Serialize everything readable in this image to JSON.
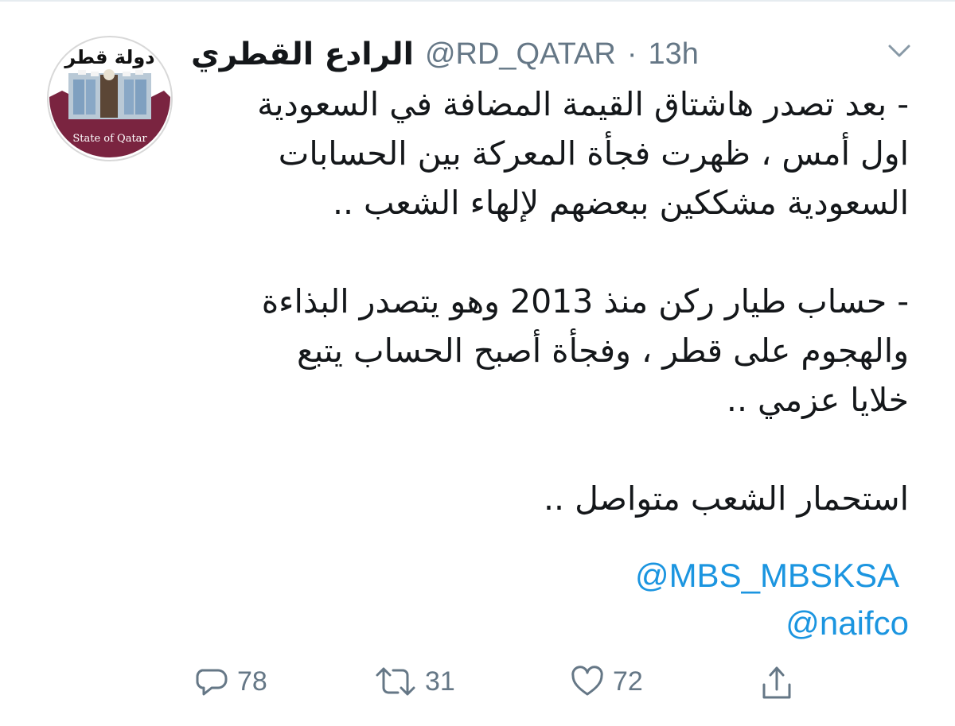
{
  "tweet": {
    "author": {
      "display_name": "الرادع القطري",
      "handle": "@RD_QATAR",
      "separator": "·",
      "time": "13h",
      "avatar_text_top": "دولة قطر",
      "avatar_text_bottom": "State of Qatar"
    },
    "menu_icon": "chevron-down-icon",
    "body_lines": [
      "- بعد تصدر هاشتاق القيمة المضافة في السعودية",
      "اول أمس ، ظهرت فجأة المعركة بين الحسابات",
      "السعودية مشككين ببعضهم لإلهاء الشعب ..",
      "",
      "- حساب طيار ركن منذ 2013 وهو يتصدر البذاءة",
      "والهجوم على قطر ، وفجأة أصبح الحساب يتبع",
      "خلايا عزمي ..",
      "",
      "استحمار الشعب متواصل .."
    ],
    "mentions": [
      "@MBS_MBSKSA",
      "@naifco"
    ],
    "actions": {
      "reply": {
        "icon": "reply-icon",
        "count": "78"
      },
      "retweet": {
        "icon": "retweet-icon",
        "count": "31"
      },
      "like": {
        "icon": "heart-icon",
        "count": "72"
      },
      "share": {
        "icon": "share-icon"
      }
    },
    "colors": {
      "text": "#14171a",
      "secondary": "#657786",
      "link": "#1b95e0",
      "avatar_maroon": "#7a2440"
    }
  }
}
